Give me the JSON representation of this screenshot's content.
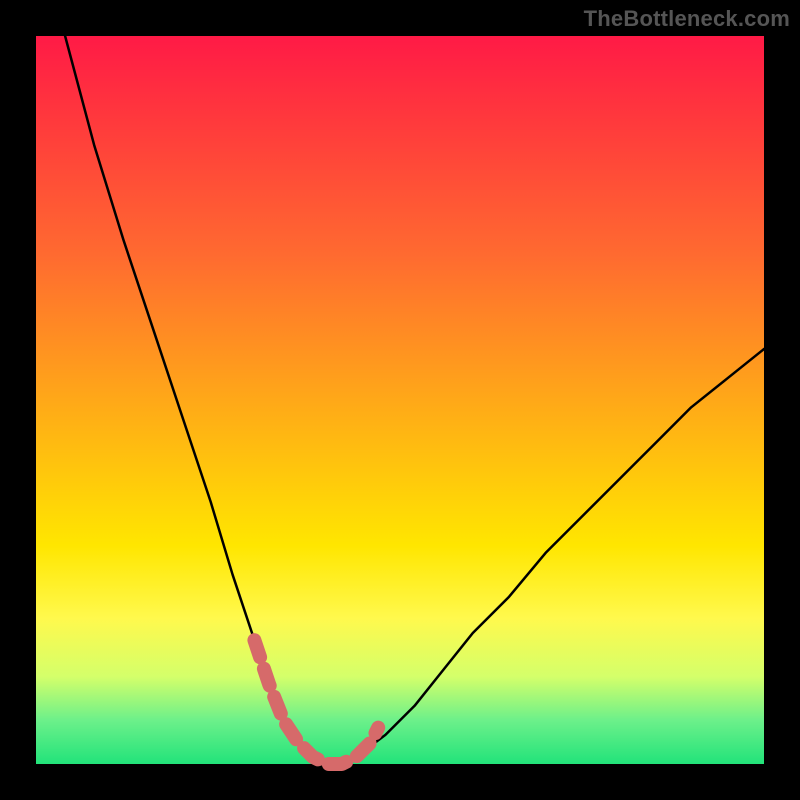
{
  "watermark": "TheBottleneck.com",
  "chart_data": {
    "type": "line",
    "title": "",
    "xlabel": "",
    "ylabel": "",
    "xlim": [
      0,
      100
    ],
    "ylim": [
      0,
      100
    ],
    "series": [
      {
        "name": "bottleneck-curve",
        "x": [
          4,
          8,
          12,
          16,
          20,
          24,
          27,
          30,
          32,
          34,
          36,
          38,
          40,
          42,
          44,
          48,
          52,
          56,
          60,
          65,
          70,
          75,
          80,
          85,
          90,
          95,
          100
        ],
        "y": [
          100,
          85,
          72,
          60,
          48,
          36,
          26,
          17,
          11,
          6,
          3,
          1,
          0,
          0,
          1,
          4,
          8,
          13,
          18,
          23,
          29,
          34,
          39,
          44,
          49,
          53,
          57
        ]
      },
      {
        "name": "highlight-segment",
        "x": [
          30,
          32,
          34,
          36,
          38,
          40,
          42,
          44,
          46,
          47
        ],
        "y": [
          17,
          11,
          6,
          3,
          1,
          0,
          0,
          1,
          3,
          5
        ]
      }
    ],
    "colors": {
      "curve": "#000000",
      "highlight": "#d66a6a"
    }
  }
}
